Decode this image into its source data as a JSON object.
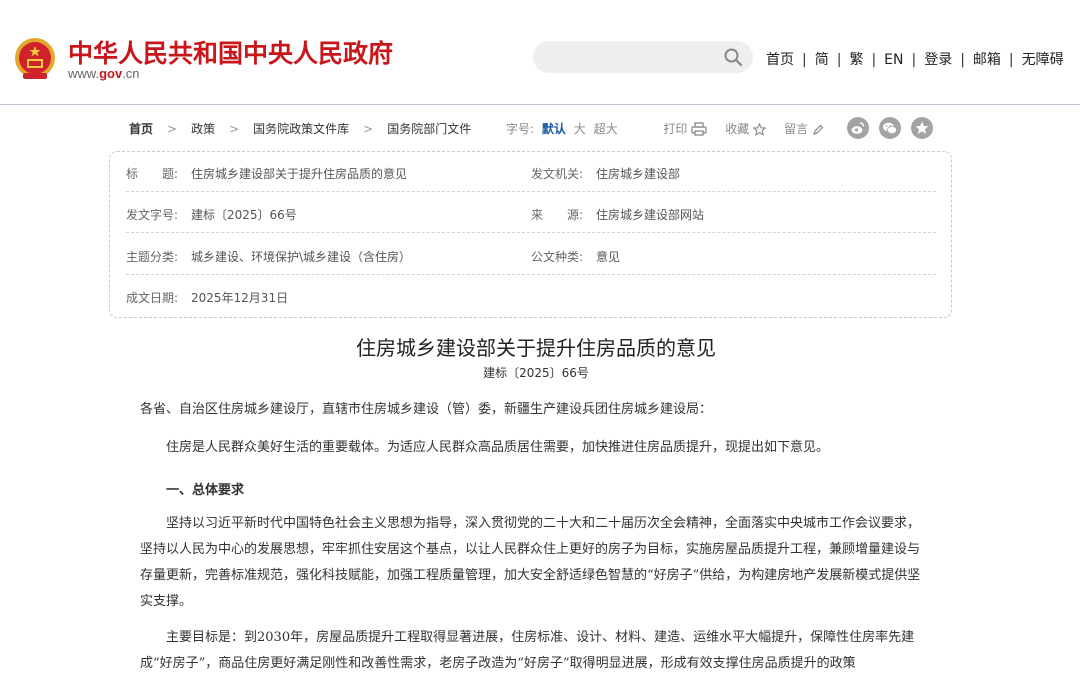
{
  "header": {
    "site_title": "中华人民共和国中央人民政府",
    "site_url_prefix": "www.",
    "site_url_brand": "gov",
    "site_url_suffix": ".cn",
    "nav": [
      "首页",
      "简",
      "繁",
      "EN",
      "登录",
      "邮箱",
      "无障碍"
    ],
    "brand_color": "#c7161c"
  },
  "breadcrumb": [
    "首页",
    "政策",
    "国务院政策文件库",
    "国务院部门文件"
  ],
  "tools": {
    "font_label": "字号:",
    "font_sizes": [
      "默认",
      "大",
      "超大"
    ],
    "print": "打印",
    "favorite": "收藏",
    "comment": "留言"
  },
  "share_icons": [
    "weibo-icon",
    "wechat-icon",
    "favorite-star-icon"
  ],
  "info": {
    "title_label": "标　　题:",
    "title_value": "住房城乡建设部关于提升住房品质的意见",
    "issuer_label": "发文机关:",
    "issuer_value": "住房城乡建设部",
    "docno_label": "发文字号:",
    "docno_value": "建标〔2025〕66号",
    "source_label": "来　　源:",
    "source_value": "住房城乡建设部网站",
    "topic_label": "主题分类:",
    "topic_value": "城乡建设、环境保护\\城乡建设（含住房）",
    "type_label": "公文种类:",
    "type_value": "意见",
    "date_label": "成文日期:",
    "date_value": "2025年12月31日"
  },
  "document": {
    "title": "住房城乡建设部关于提升住房品质的意见",
    "number": "建标〔2025〕66号",
    "salutation": "各省、自治区住房城乡建设厅，直辖市住房城乡建设（管）委，新疆生产建设兵团住房城乡建设局：",
    "intro": "住房是人民群众美好生活的重要载体。为适应人民群众高品质居住需要，加快推进住房品质提升，现提出如下意见。",
    "section1": "一、总体要求",
    "para1": "坚持以习近平新时代中国特色社会主义思想为指导，深入贯彻党的二十大和二十届历次全会精神，全面落实中央城市工作会议要求，坚持以人民为中心的发展思想，牢牢抓住安居这个基点，以让人民群众住上更好的房子为目标，实施房屋品质提升工程，兼顾增量建设与存量更新，完善标准规范，强化科技赋能，加强工程质量管理，加大安全舒适绿色智慧的“好房子”供给，为构建房地产发展新模式提供坚实支撑。",
    "para2": "主要目标是：到2030年，房屋品质提升工程取得显著进展，住房标准、设计、材料、建造、运维水平大幅提升，保障性住房率先建成“好房子”，商品住房更好满足刚性和改善性需求，老房子改造为“好房子”取得明显进展，形成有效支撑住房品质提升的政策"
  }
}
